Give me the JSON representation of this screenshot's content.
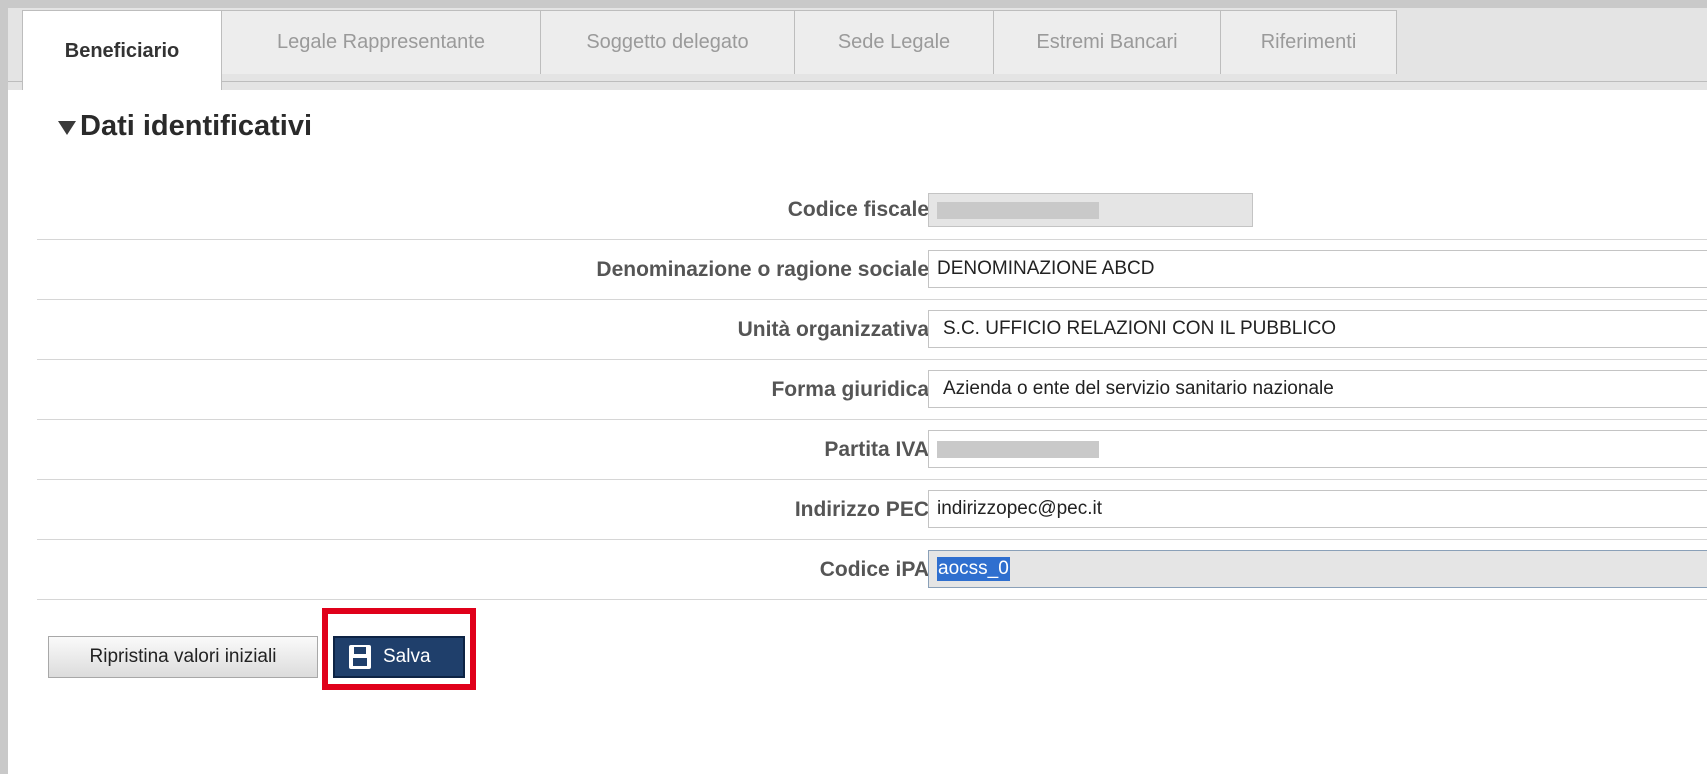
{
  "tabs": [
    {
      "label": "Beneficiario",
      "active": true
    },
    {
      "label": "Legale Rappresentante",
      "active": false
    },
    {
      "label": "Soggetto delegato",
      "active": false
    },
    {
      "label": "Sede Legale",
      "active": false
    },
    {
      "label": "Estremi Bancari",
      "active": false
    },
    {
      "label": "Riferimenti",
      "active": false
    }
  ],
  "section": {
    "title": "Dati identificativi"
  },
  "form": {
    "codice_fiscale": {
      "label": "Codice fiscale",
      "value": ""
    },
    "denominazione": {
      "label": "Denominazione o ragione sociale",
      "value": "DENOMINAZIONE ABCD"
    },
    "unita": {
      "label": "Unità organizzativa",
      "value": "S.C. UFFICIO RELAZIONI CON IL PUBBLICO"
    },
    "forma": {
      "label": "Forma giuridica",
      "value": "Azienda o ente del servizio sanitario nazionale"
    },
    "partita_iva": {
      "label": "Partita IVA",
      "value": ""
    },
    "pec": {
      "label": "Indirizzo PEC",
      "value": "indirizzopec@pec.it"
    },
    "ipa": {
      "label": "Codice iPA",
      "value": "aocss_0"
    }
  },
  "buttons": {
    "reset_label": "Ripristina valori iniziali",
    "save_label": "Salva"
  },
  "colors": {
    "highlight": "#e0001a",
    "save_button": "#1f3f6b"
  }
}
